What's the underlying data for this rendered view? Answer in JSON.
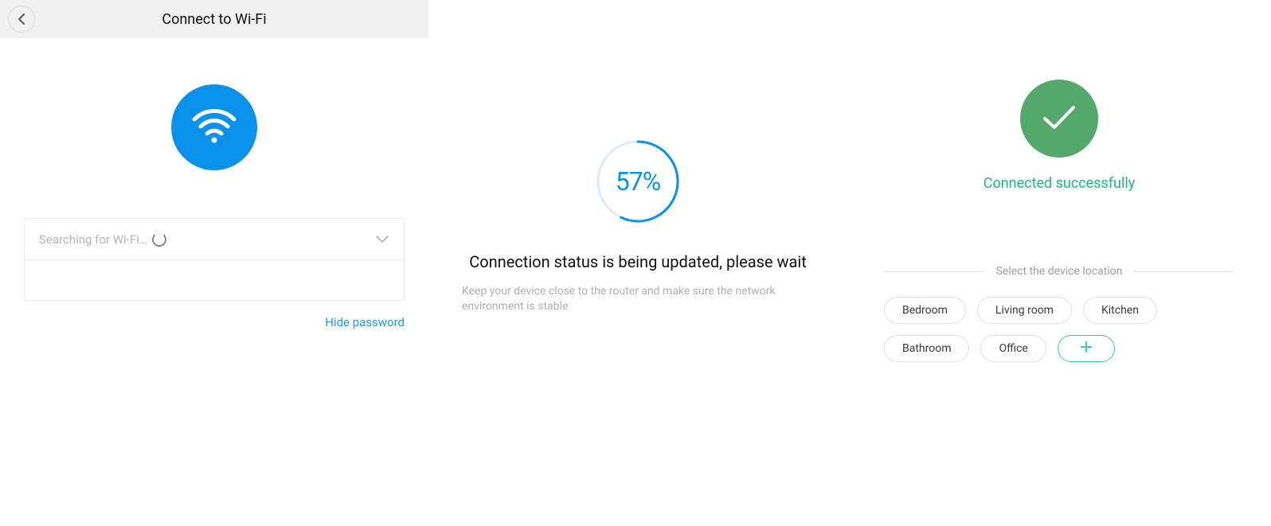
{
  "colors": {
    "accent_blue": "#0a91eb",
    "link_blue": "#2196f3",
    "success_green_badge": "#53a86c",
    "success_green_text": "#1aba7a",
    "chip_add_green": "#3fcf8e"
  },
  "panel1": {
    "header_title": "Connect to Wi-Fi",
    "wifi_select_label": "Searching for Wi-Fi…",
    "password_placeholder": "",
    "hide_password_label": "Hide password"
  },
  "panel2": {
    "progress_percent": 57,
    "progress_text": "57%",
    "title": "Connection status is being updated, please wait",
    "subtitle": "Keep your device close to the router and make sure the network environment is stable"
  },
  "panel3": {
    "status_text": "Connected successfully",
    "divider_label": "Select the device location",
    "chips": [
      "Bedroom",
      "Living room",
      "Kitchen",
      "Bathroom",
      "Office"
    ]
  }
}
